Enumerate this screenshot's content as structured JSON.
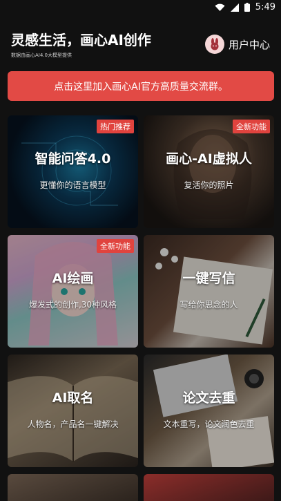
{
  "status_bar": {
    "time": "5:49"
  },
  "header": {
    "title": "灵感生活，画心AI创作",
    "subtitle": "数据由画心AI4.0大模型提供",
    "user_center_label": "用户中心"
  },
  "banner": {
    "text": "点击这里加入画心AI官方高质量交流群。"
  },
  "cards": [
    {
      "title": "智能问答4.0",
      "desc": "更懂你的语言模型",
      "badge": "热门推荐"
    },
    {
      "title": "画心-AI虚拟人",
      "desc": "复活你的照片",
      "badge": "全新功能"
    },
    {
      "title": "AI绘画",
      "desc": "爆发式的创作,30种风格",
      "badge": "全新功能"
    },
    {
      "title": "一键写信",
      "desc": "写给你思念的人",
      "badge": ""
    },
    {
      "title": "AI取名",
      "desc": "人物名，产品名一键解决",
      "badge": ""
    },
    {
      "title": "论文去重",
      "desc": "文本重写，论文润色去重",
      "badge": ""
    }
  ],
  "colors": {
    "accent": "#e24a45",
    "background": "#111111",
    "badge": "#e0433e"
  }
}
